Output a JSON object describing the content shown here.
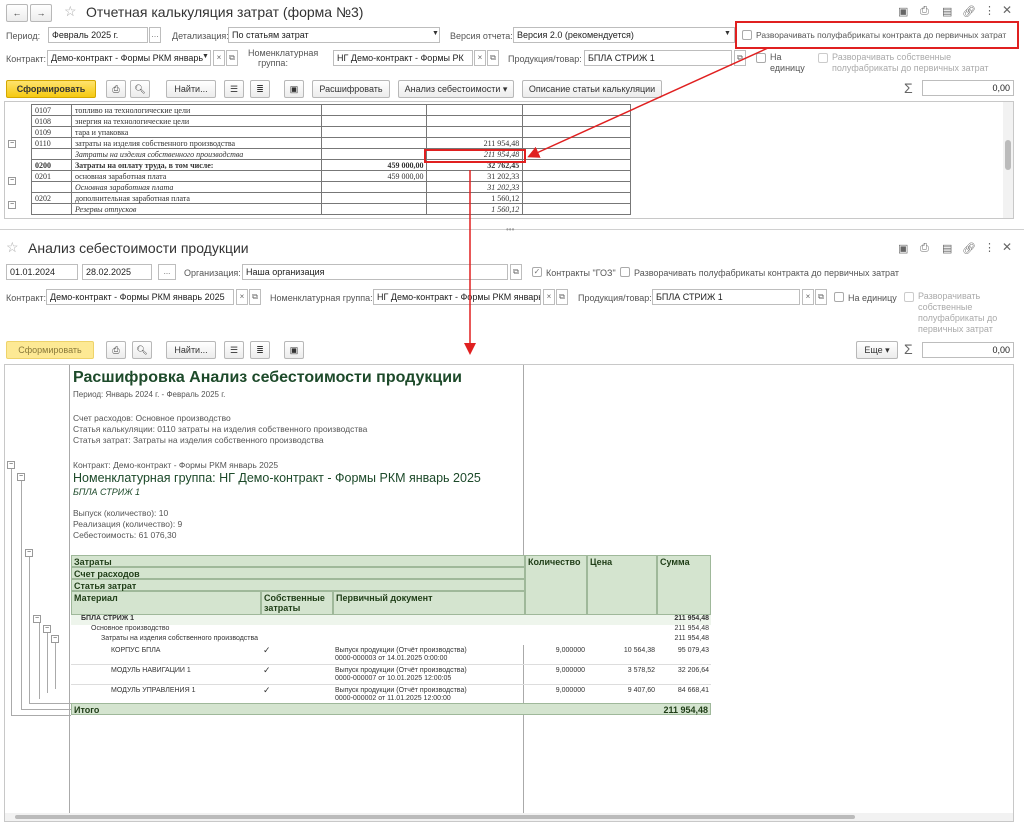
{
  "top": {
    "title": "Отчетная калькуляция затрат (форма №3)",
    "period_label": "Период:",
    "period_value": "Февраль 2025 г.",
    "detail_label": "Детализация:",
    "detail_value": "По статьям затрат",
    "version_label": "Версия отчета:",
    "version_value": "Версия 2.0 (рекомендуется)",
    "expand_label": "Разворачивать полуфабрикаты контракта до первичных затрат",
    "contract_label": "Контракт:",
    "contract_value": "Демо-контракт - Формы РКМ январь",
    "nom_label1": "Номенклатурная",
    "nom_label2": "группа:",
    "nom_value": "НГ Демо-контракт - Формы РК",
    "product_label": "Продукция/товар:",
    "product_value": "БПЛА СТРИЖ 1",
    "unit_label1": "На",
    "unit_label2": "единицу",
    "own_label1": "Разворачивать собственные",
    "own_label2": "полуфабрикаты до первичных затрат",
    "btn_generate": "Сформировать",
    "btn_find": "Найти...",
    "btn_decode": "Расшифровать",
    "btn_analysis": "Анализ себестоимости",
    "btn_description": "Описание статьи калькуляции",
    "sum_value": "0,00"
  },
  "sheet1": [
    {
      "code": "0107",
      "name": "топливо на технологические цели",
      "c3": "",
      "c4": "",
      "italic": false,
      "bold": false
    },
    {
      "code": "0108",
      "name": "энергия на технологические цели",
      "c3": "",
      "c4": "",
      "italic": false,
      "bold": false
    },
    {
      "code": "0109",
      "name": "тара и упаковка",
      "c3": "",
      "c4": "",
      "italic": false,
      "bold": false
    },
    {
      "code": "0110",
      "name": "затраты на изделия собственного производства",
      "c3": "",
      "c4": "211 954,48",
      "italic": false,
      "bold": false
    },
    {
      "code": "",
      "name": "Затраты на изделия собственного производства",
      "c3": "",
      "c4": "211 954,48",
      "italic": true,
      "bold": false
    },
    {
      "code": "0200",
      "name": "Затраты на оплату труда, в том числе:",
      "c3": "459 000,00",
      "c4": "32 762,45",
      "italic": false,
      "bold": true
    },
    {
      "code": "0201",
      "name": "основная заработная плата",
      "c3": "459 000,00",
      "c4": "31 202,33",
      "italic": false,
      "bold": false
    },
    {
      "code": "",
      "name": "Основная заработная плата",
      "c3": "",
      "c4": "31 202,33",
      "italic": true,
      "bold": false
    },
    {
      "code": "0202",
      "name": "дополнительная заработная плата",
      "c3": "",
      "c4": "1 560,12",
      "italic": false,
      "bold": false
    },
    {
      "code": "",
      "name": "Резервы отпусков",
      "c3": "",
      "c4": "1 560,12",
      "italic": true,
      "bold": false
    }
  ],
  "bottom": {
    "title": "Анализ себестоимости продукции",
    "date_from": "01.01.2024",
    "date_to": "28.02.2025",
    "dots": "...",
    "org_label": "Организация:",
    "org_value": "Наша организация",
    "goz_label": "Контракты \"ГОЗ\"",
    "expand_label": "Разворачивать полуфабрикаты контракта до первичных затрат",
    "contract_label": "Контракт:",
    "contract_value": "Демо-контракт - Формы РКМ январь 2025",
    "nom_label": "Номенклатурная группа:",
    "nom_value": "НГ Демо-контракт - Формы РКМ январь",
    "product_label": "Продукция/товар:",
    "product_value": "БПЛА СТРИЖ 1",
    "unit_label": "На единицу",
    "own_label1": "Разворачивать",
    "own_label2": "собственные",
    "own_label3": "полуфабрикаты до",
    "own_label4": "первичных затрат",
    "btn_generate": "Сформировать",
    "btn_find": "Найти...",
    "btn_more": "Еще",
    "sum_value": "0,00"
  },
  "report": {
    "title": "Расшифровка Анализ себестоимости продукции",
    "period": "Период: Январь 2024 г. - Февраль 2025 г.",
    "account": "Счет расходов: Основное производство",
    "article": "Статья калькуляции: 0110 затраты на изделия собственного производства",
    "cost_item": "Статья затрат: Затраты на изделия собственного производства",
    "contract": "Контракт: Демо-контракт - Формы РКМ январь 2025",
    "group": "Номенклатурная группа: НГ Демо-контракт - Формы РКМ январь 2025",
    "product": "БПЛА СТРИЖ 1",
    "output": "Выпуск (количество): 10",
    "sales": "Реализация (количество): 9",
    "cost": "Себестоимость: 61 076,30",
    "h_costs": "Затраты",
    "h_account": "Счет расходов",
    "h_article": "Статья затрат",
    "h_material": "Материал",
    "h_own1": "Собственные",
    "h_own2": "затраты",
    "h_doc": "Первичный документ",
    "h_qty": "Количество",
    "h_price": "Цена",
    "h_sum": "Сумма",
    "g1": "БПЛА СТРИЖ 1",
    "g1_sum": "211 954,48",
    "g2": "Основное производство",
    "g2_sum": "211 954,48",
    "g3": "Затраты на изделия собственного производства",
    "g3_sum": "211 954,48",
    "rows": [
      {
        "material": "КОРПУС БПЛА",
        "check": "✓",
        "doc1": "Выпуск продукции (Отчёт производства)",
        "doc2": "0000-000003 от 14.01.2025 0:00:00",
        "qty": "9,000000",
        "price": "10 564,38",
        "sum": "95 079,43"
      },
      {
        "material": "МОДУЛЬ НАВИГАЦИИ 1",
        "check": "✓",
        "doc1": "Выпуск продукции (Отчёт производства)",
        "doc2": "0000-000007 от 10.01.2025 12:00:05",
        "qty": "9,000000",
        "price": "3 578,52",
        "sum": "32 206,64"
      },
      {
        "material": "МОДУЛЬ УПРАВЛЕНИЯ 1",
        "check": "✓",
        "doc1": "Выпуск продукции (Отчёт производства)",
        "doc2": "0000-000002 от 11.01.2025 12:00:00",
        "qty": "9,000000",
        "price": "9 407,60",
        "sum": "84 668,41"
      }
    ],
    "total_label": "Итого",
    "total_sum": "211 954,48"
  }
}
